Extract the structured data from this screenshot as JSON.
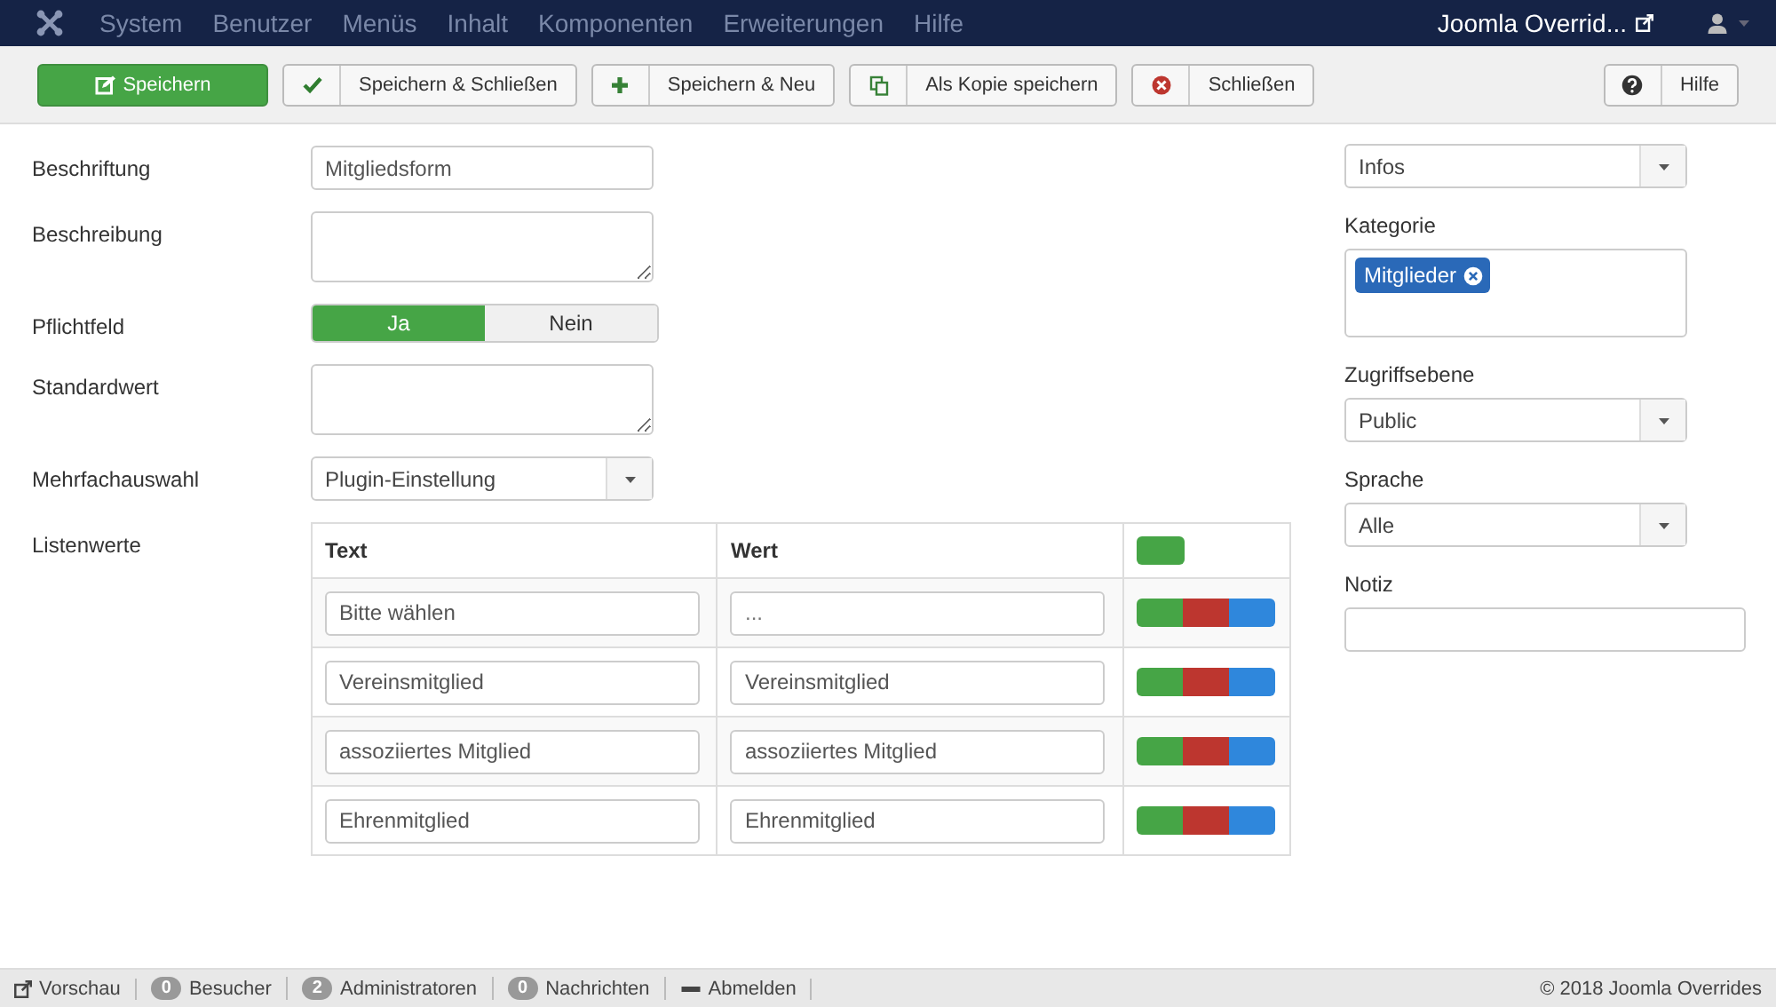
{
  "menu_bar": {
    "items": [
      "System",
      "Benutzer",
      "Menüs",
      "Inhalt",
      "Komponenten",
      "Erweiterungen",
      "Hilfe"
    ],
    "site_link": "Joomla Overrid..."
  },
  "toolbar": {
    "buttons": [
      {
        "label": "Speichern",
        "kind": "save"
      },
      {
        "label": "Speichern & Schließen",
        "kind": "check"
      },
      {
        "label": "Speichern & Neu",
        "kind": "plus"
      },
      {
        "label": "Als Kopie speichern",
        "kind": "copy"
      },
      {
        "label": "Schließen",
        "kind": "close"
      }
    ],
    "help": "Hilfe"
  },
  "form": {
    "fields": [
      {
        "label": "Beschriftung",
        "kind": "text",
        "value": "Mitgliedsform"
      },
      {
        "label": "Beschreibung",
        "kind": "textarea"
      },
      {
        "label": "Pflichtfeld",
        "kind": "toggle",
        "options": [
          {
            "label": "Ja",
            "selected": true
          },
          {
            "label": "Nein",
            "selected": false
          }
        ]
      },
      {
        "label": "Standardwert",
        "kind": "textarea"
      },
      {
        "label": "Mehrfachauswahl",
        "kind": "select",
        "value": "Plugin-Einstellung"
      },
      {
        "label": "Listenwerte",
        "kind": "list"
      }
    ]
  },
  "list_table": {
    "columns": [
      "Text",
      "Wert"
    ],
    "rows": [
      {
        "text": "Bitte wählen",
        "value_placeholder": "..."
      },
      {
        "text": "Vereinsmitglied",
        "value": "Vereinsmitglied"
      },
      {
        "text": "assoziiertes Mitglied",
        "value": "assoziiertes Mitglied"
      },
      {
        "text": "Ehrenmitglied",
        "value": "Ehrenmitglied"
      }
    ]
  },
  "sidebar": {
    "fields": [
      {
        "kind": "select",
        "value": "Infos"
      },
      {
        "label": "Kategorie",
        "kind": "tags",
        "tags": [
          "Mitglieder"
        ]
      },
      {
        "label": "Zugriffsebene",
        "kind": "select",
        "value": "Public"
      },
      {
        "label": "Sprache",
        "kind": "select",
        "value": "Alle"
      },
      {
        "label": "Notiz",
        "kind": "text"
      }
    ]
  },
  "status_bar": {
    "items": [
      {
        "label": "Vorschau",
        "kind": "preview"
      },
      {
        "label": "Besucher",
        "count": "0",
        "kind": "count"
      },
      {
        "label": "Administratoren",
        "count": "2",
        "kind": "count"
      },
      {
        "label": "Nachrichten",
        "count": "0",
        "kind": "count"
      },
      {
        "label": "Abmelden",
        "kind": "logout"
      }
    ],
    "copyright": "© 2018 Joomla Overrides"
  }
}
